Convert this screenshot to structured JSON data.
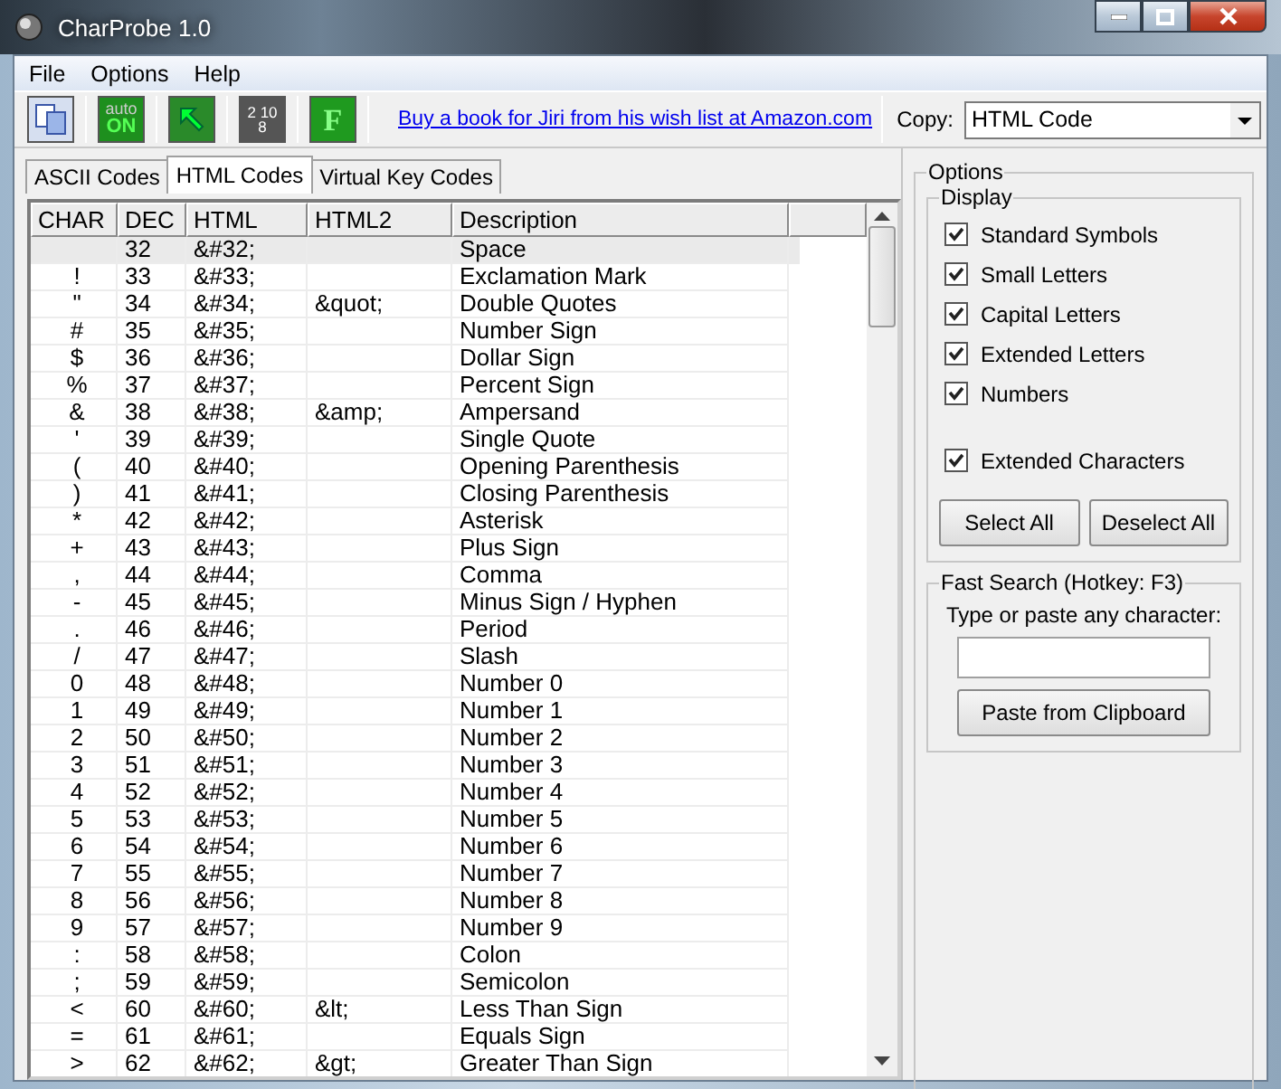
{
  "window": {
    "title": "CharProbe 1.0"
  },
  "menu": [
    "File",
    "Options",
    "Help"
  ],
  "toolbar": [
    {
      "kind": "copy"
    },
    {
      "kind": "auto",
      "lines": [
        "auto",
        "ON"
      ]
    },
    {
      "kind": "arrow"
    },
    {
      "kind": "bases",
      "lines": [
        "2",
        "10",
        "8"
      ]
    },
    {
      "kind": "font",
      "lines": [
        "F"
      ]
    }
  ],
  "link": "Buy a book for Jiri from his wish list at Amazon.com",
  "copy": {
    "label": "Copy:",
    "value": "HTML Code"
  },
  "tabs": [
    {
      "label": "ASCII Codes",
      "selected": false
    },
    {
      "label": "HTML Codes",
      "selected": true
    },
    {
      "label": "Virtual Key Codes",
      "selected": false
    }
  ],
  "table": {
    "columns": [
      "CHAR",
      "DEC",
      "HTML",
      "HTML2",
      "Description"
    ],
    "rows": [
      {
        "dec": "32",
        "html": "&#32;",
        "description": "Space",
        "selected": true
      },
      {
        "char": "!",
        "dec": "33",
        "html": "&#33;",
        "description": "Exclamation Mark",
        "selected": false
      },
      {
        "char": "\"",
        "dec": "34",
        "html": "&#34;",
        "html2": "&quot;",
        "description": "Double Quotes",
        "selected": false
      },
      {
        "char": "#",
        "dec": "35",
        "html": "&#35;",
        "description": "Number Sign",
        "selected": false
      },
      {
        "char": "$",
        "dec": "36",
        "html": "&#36;",
        "description": "Dollar Sign",
        "selected": false
      },
      {
        "char": "%",
        "dec": "37",
        "html": "&#37;",
        "description": "Percent Sign",
        "selected": false
      },
      {
        "char": "&",
        "dec": "38",
        "html": "&#38;",
        "html2": "&amp;",
        "description": "Ampersand",
        "selected": false
      },
      {
        "char": "'",
        "dec": "39",
        "html": "&#39;",
        "description": "Single Quote",
        "selected": false
      },
      {
        "char": "(",
        "dec": "40",
        "html": "&#40;",
        "description": "Opening Parenthesis",
        "selected": false
      },
      {
        "char": ")",
        "dec": "41",
        "html": "&#41;",
        "description": "Closing Parenthesis",
        "selected": false
      },
      {
        "char": "*",
        "dec": "42",
        "html": "&#42;",
        "description": "Asterisk",
        "selected": false
      },
      {
        "char": "+",
        "dec": "43",
        "html": "&#43;",
        "description": "Plus Sign",
        "selected": false
      },
      {
        "char": ",",
        "dec": "44",
        "html": "&#44;",
        "description": "Comma",
        "selected": false
      },
      {
        "char": "-",
        "dec": "45",
        "html": "&#45;",
        "description": "Minus Sign / Hyphen",
        "selected": false
      },
      {
        "char": ".",
        "dec": "46",
        "html": "&#46;",
        "description": "Period",
        "selected": false
      },
      {
        "char": "/",
        "dec": "47",
        "html": "&#47;",
        "description": "Slash",
        "selected": false
      },
      {
        "char": "0",
        "dec": "48",
        "html": "&#48;",
        "description": "Number 0",
        "selected": false
      },
      {
        "char": "1",
        "dec": "49",
        "html": "&#49;",
        "description": "Number 1",
        "selected": false
      },
      {
        "char": "2",
        "dec": "50",
        "html": "&#50;",
        "description": "Number 2",
        "selected": false
      },
      {
        "char": "3",
        "dec": "51",
        "html": "&#51;",
        "description": "Number 3",
        "selected": false
      },
      {
        "char": "4",
        "dec": "52",
        "html": "&#52;",
        "description": "Number 4",
        "selected": false
      },
      {
        "char": "5",
        "dec": "53",
        "html": "&#53;",
        "description": "Number 5",
        "selected": false
      },
      {
        "char": "6",
        "dec": "54",
        "html": "&#54;",
        "description": "Number 6",
        "selected": false
      },
      {
        "char": "7",
        "dec": "55",
        "html": "&#55;",
        "description": "Number 7",
        "selected": false
      },
      {
        "char": "8",
        "dec": "56",
        "html": "&#56;",
        "description": "Number 8",
        "selected": false
      },
      {
        "char": "9",
        "dec": "57",
        "html": "&#57;",
        "description": "Number 9",
        "selected": false
      },
      {
        "char": ":",
        "dec": "58",
        "html": "&#58;",
        "description": "Colon",
        "selected": false
      },
      {
        "char": ";",
        "dec": "59",
        "html": "&#59;",
        "description": "Semicolon",
        "selected": false
      },
      {
        "char": "<",
        "dec": "60",
        "html": "&#60;",
        "html2": "&lt;",
        "description": "Less Than Sign",
        "selected": false
      },
      {
        "char": "=",
        "dec": "61",
        "html": "&#61;",
        "description": "Equals Sign",
        "selected": false
      },
      {
        "char": ">",
        "dec": "62",
        "html": "&#62;",
        "html2": "&gt;",
        "description": "Greater Than Sign",
        "selected": false
      }
    ]
  },
  "options": {
    "title": "Options",
    "display": {
      "title": "Display",
      "groups": [
        [
          {
            "label": "Standard Symbols",
            "checked": true
          },
          {
            "label": "Small Letters",
            "checked": true
          },
          {
            "label": "Capital Letters",
            "checked": true
          },
          {
            "label": "Extended Letters",
            "checked": true
          },
          {
            "label": "Numbers",
            "checked": true
          }
        ],
        [
          {
            "label": "Extended Characters",
            "checked": true
          }
        ]
      ],
      "buttons": [
        "Select All",
        "Deselect All"
      ]
    },
    "fast_search": {
      "title": "Fast Search (Hotkey: F3)",
      "prompt": "Type or paste any character:",
      "button": "Paste from Clipboard"
    }
  }
}
